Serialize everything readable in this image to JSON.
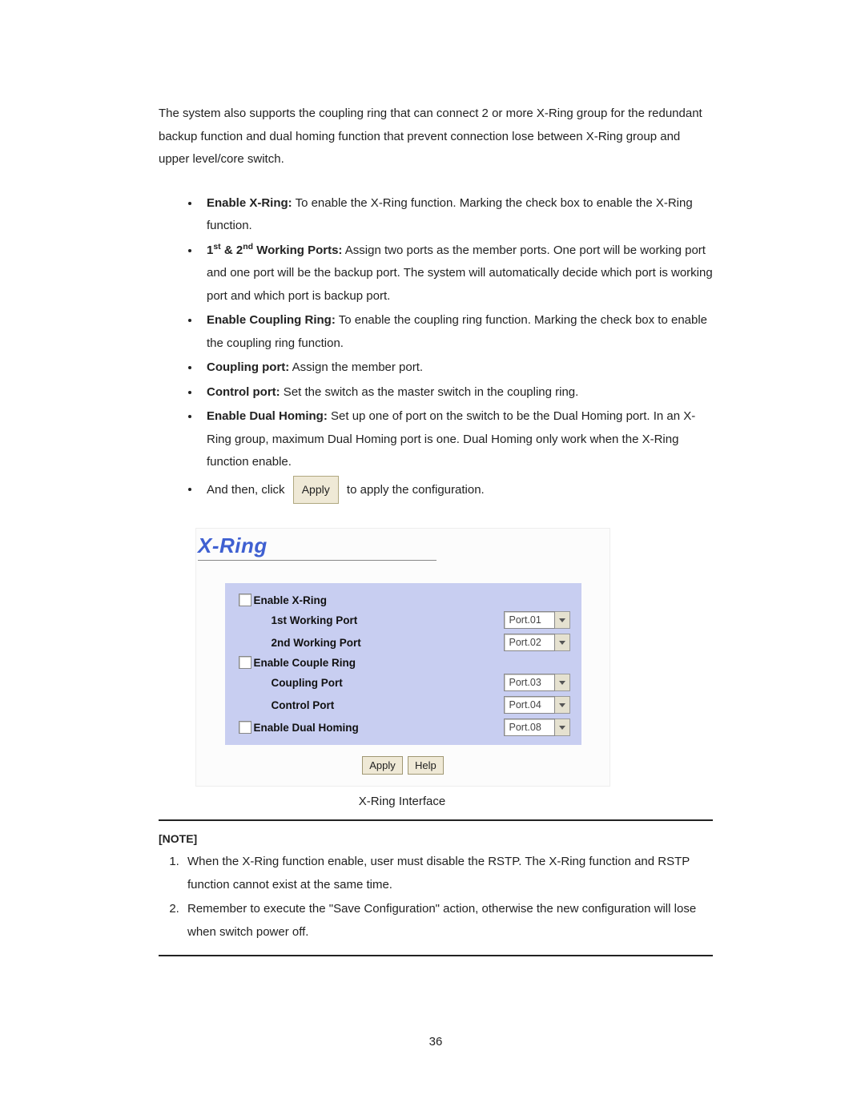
{
  "intro": "The system also supports the coupling ring that can connect 2 or more X-Ring group for the redundant backup function and dual homing function that prevent connection lose between X-Ring group and upper level/core switch.",
  "bullets": {
    "b1_head": "Enable X-Ring:",
    "b1_rest": " To enable the X-Ring function. Marking the check box to enable the X-Ring function.",
    "b2_head_a": "1",
    "b2_head_sup_a": "st",
    "b2_head_amp": " & 2",
    "b2_head_sup_b": "nd",
    "b2_head_b": " Working Ports:",
    "b2_rest": " Assign two ports as the member ports. One port will be working port and one port will be the backup port. The system will automatically decide which port is working port and which port is backup port.",
    "b3_head": "Enable Coupling Ring:",
    "b3_rest": " To enable the coupling ring function. Marking the check box to enable the coupling ring function.",
    "b4_head": "Coupling port:",
    "b4_rest": " Assign the member port.",
    "b5_head": "Control port:",
    "b5_rest": " Set the switch as the master switch in the coupling ring.",
    "b6_head": "Enable Dual Homing:",
    "b6_rest": " Set up one of port on the switch to be the Dual Homing port. In an X-Ring group, maximum Dual Homing port is one. Dual Homing only work when the X-Ring function enable.",
    "b7_pre": "And then, click ",
    "b7_btn": "Apply",
    "b7_post": " to apply the configuration."
  },
  "panel": {
    "title": "X-Ring",
    "rows": {
      "enable_xring": "Enable X-Ring",
      "first_wp": "1st Working Port",
      "first_wp_val": "Port.01",
      "second_wp": "2nd Working Port",
      "second_wp_val": "Port.02",
      "enable_couple": "Enable Couple Ring",
      "coupling_port": "Coupling Port",
      "coupling_port_val": "Port.03",
      "control_port": "Control Port",
      "control_port_val": "Port.04",
      "enable_dual": "Enable Dual Homing",
      "dual_val": "Port.08"
    },
    "apply_btn": "Apply",
    "help_btn": "Help",
    "caption": "X-Ring Interface"
  },
  "note": {
    "heading": "[NOTE]",
    "n1": "When the X-Ring function enable, user must disable the RSTP. The X-Ring function and RSTP function cannot exist at the same time.",
    "n2": "Remember to execute the \"Save Configuration\" action, otherwise the new configuration will lose when switch power off."
  },
  "page_number": "36"
}
